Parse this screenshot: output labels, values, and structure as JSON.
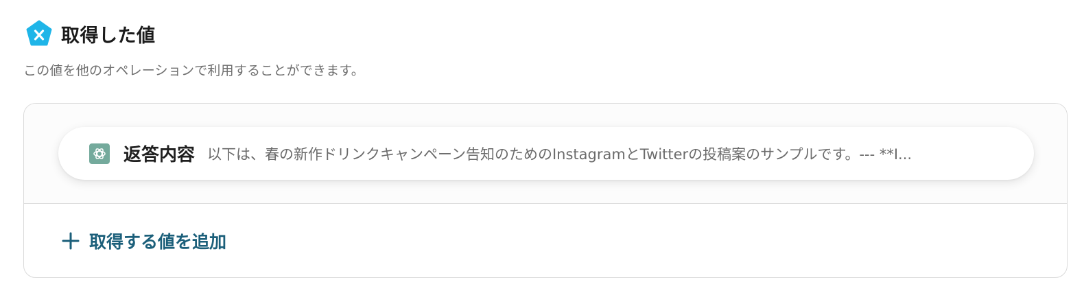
{
  "header": {
    "icon": "variable-x-icon",
    "title": "取得した値"
  },
  "description": "この値を他のオペレーションで利用することができます。",
  "values": [
    {
      "icon": "openai-icon",
      "name": "返答内容",
      "preview": "以下は、春の新作ドリンクキャンペーン告知のためのInstagramとTwitterの投稿案のサンプルです。--- **I..."
    }
  ],
  "add_button": {
    "icon": "plus-icon",
    "label": "取得する値を追加"
  },
  "colors": {
    "icon_blue": "#1fb5e8",
    "accent_teal": "#1b5f7a",
    "openai_green": "#74aa9c",
    "border": "#dadada"
  }
}
